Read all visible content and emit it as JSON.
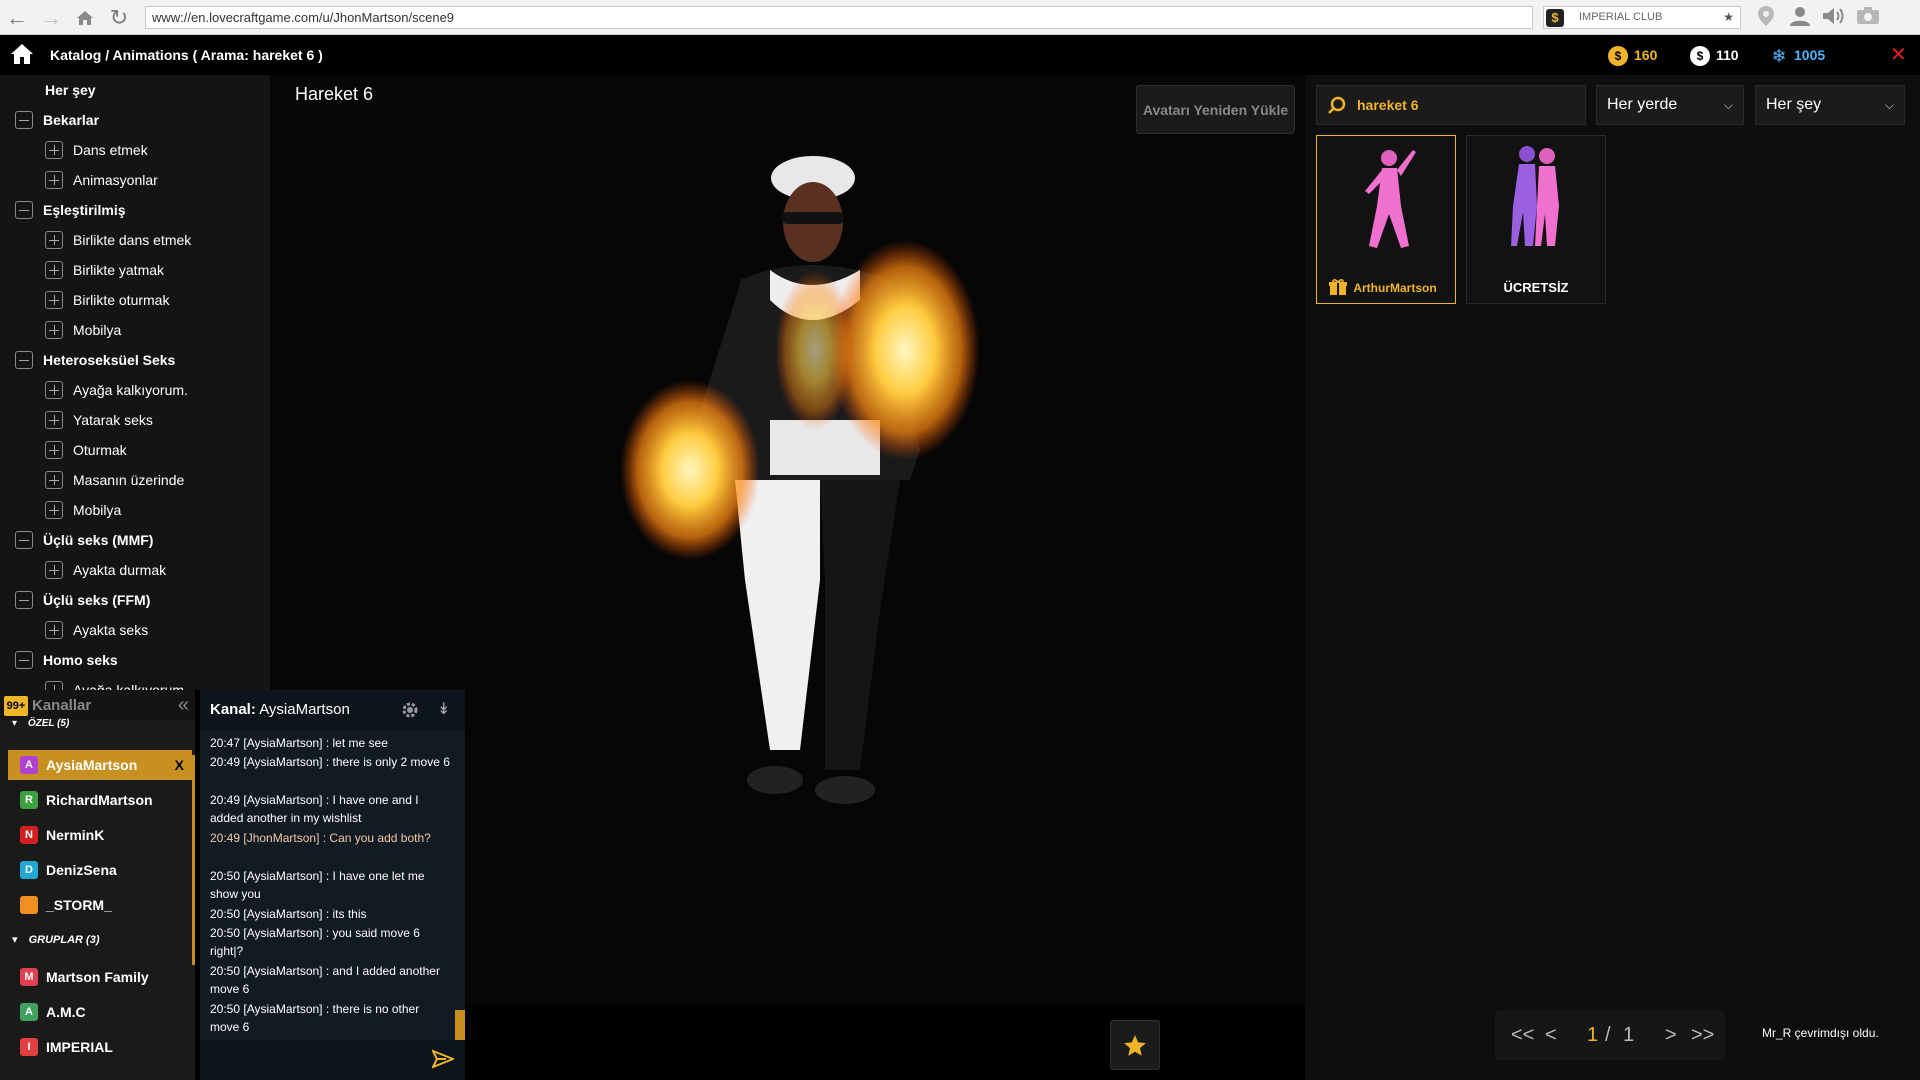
{
  "browser": {
    "url": "www://en.lovecraftgame.com/u/JhonMartson/scene9",
    "extension_label": "IMPERIAL CLUB"
  },
  "topbar": {
    "breadcrumb": "Katalog / Animations ( Arama: hareket 6 )",
    "gold": "160",
    "silver": "110",
    "crystals": "1005",
    "colors": {
      "gold": "#f0b428",
      "silver": "#ffffff",
      "crystal": "#4fb4ff",
      "close": "#e02020"
    }
  },
  "sidebar": {
    "items": [
      {
        "label": "Her şey",
        "level": 0
      },
      {
        "label": "Bekarlar",
        "level": 0
      },
      {
        "label": "Dans etmek",
        "level": 1
      },
      {
        "label": "Animasyonlar",
        "level": 1
      },
      {
        "label": "Eşleştirilmiş",
        "level": 0
      },
      {
        "label": "Birlikte dans etmek",
        "level": 1
      },
      {
        "label": "Birlikte yatmak",
        "level": 1
      },
      {
        "label": "Birlikte oturmak",
        "level": 1
      },
      {
        "label": "Mobilya",
        "level": 1
      },
      {
        "label": "Heteroseksüel Seks",
        "level": 0
      },
      {
        "label": "Ayağa kalkıyorum.",
        "level": 1
      },
      {
        "label": "Yatarak seks",
        "level": 1
      },
      {
        "label": "Oturmak",
        "level": 1
      },
      {
        "label": "Masanın üzerinde",
        "level": 1
      },
      {
        "label": "Mobilya",
        "level": 1
      },
      {
        "label": "Üçlü seks (MMF)",
        "level": 0
      },
      {
        "label": "Ayakta durmak",
        "level": 1
      },
      {
        "label": "Üçlü seks (FFM)",
        "level": 0
      },
      {
        "label": "Ayakta seks",
        "level": 1
      },
      {
        "label": "Homo seks",
        "level": 0
      },
      {
        "label": "Ayağa kalkıyorum.",
        "level": 1
      }
    ]
  },
  "stage": {
    "title": "Hareket 6",
    "reload_label": "Avatarı Yeniden Yükle"
  },
  "filters": {
    "search_value": "hareket 6",
    "location": "Her yerde",
    "category": "Her şey"
  },
  "results": [
    {
      "label": "ArthurMartson",
      "label_color": "#f0b428",
      "gift": true
    },
    {
      "label": "ÜCRETSİZ",
      "label_color": "#ffffff",
      "gift": false
    }
  ],
  "channels": {
    "badge": "99+",
    "title": "Kanallar",
    "private_section": "Özel (5)",
    "groups_section": "Gruplar (3)",
    "private": [
      {
        "initial": "A",
        "name": "AysiaMartson",
        "color": "#b040d0",
        "active": true
      },
      {
        "initial": "R",
        "name": "RichardMartson",
        "color": "#40a040",
        "active": false
      },
      {
        "initial": "N",
        "name": "NerminK",
        "color": "#d02020",
        "active": false
      },
      {
        "initial": "D",
        "name": "DenizSena",
        "color": "#20a8d0",
        "active": false
      },
      {
        "initial": "",
        "name": "_STORM_",
        "color": "#f09020",
        "active": false
      }
    ],
    "groups": [
      {
        "initial": "M",
        "name": "Martson Family",
        "color": "#e04050"
      },
      {
        "initial": "A",
        "name": "A.M.C",
        "color": "#40a060"
      },
      {
        "initial": "I",
        "name": "IMPERIAL",
        "color": "#e04040"
      }
    ],
    "close_label": "X"
  },
  "chat": {
    "channel_label": "Kanal:",
    "channel_name": "AysiaMartson",
    "messages": [
      {
        "text": "20:47 [AysiaMartson] : let me see",
        "self": false
      },
      {
        "text": "20:49 [AysiaMartson] : there is only 2 move 6",
        "self": false
      },
      {
        "text": "20:49 [AysiaMartson] : I have one and I added another in my wishlist",
        "self": false
      },
      {
        "text": "20:49 [JhonMartson] : Can you add both?",
        "self": true
      },
      {
        "text": "20:50 [AysiaMartson] : I have one let me show you",
        "self": false
      },
      {
        "text": "20:50 [AysiaMartson] : its this",
        "self": false
      },
      {
        "text": "20:50 [AysiaMartson] : you said move 6 right|?",
        "self": false
      },
      {
        "text": "20:50 [AysiaMartson] : and I added another move 6",
        "self": false
      },
      {
        "text": "20:50 [AysiaMartson] : there is no other move 6",
        "self": false
      }
    ]
  },
  "pager": {
    "first": "<<",
    "prev": "<",
    "current": "1",
    "separator": "/",
    "total": "1",
    "next": ">",
    "last": ">>"
  },
  "status_message": "Mr_R çevrimdışı oldu."
}
